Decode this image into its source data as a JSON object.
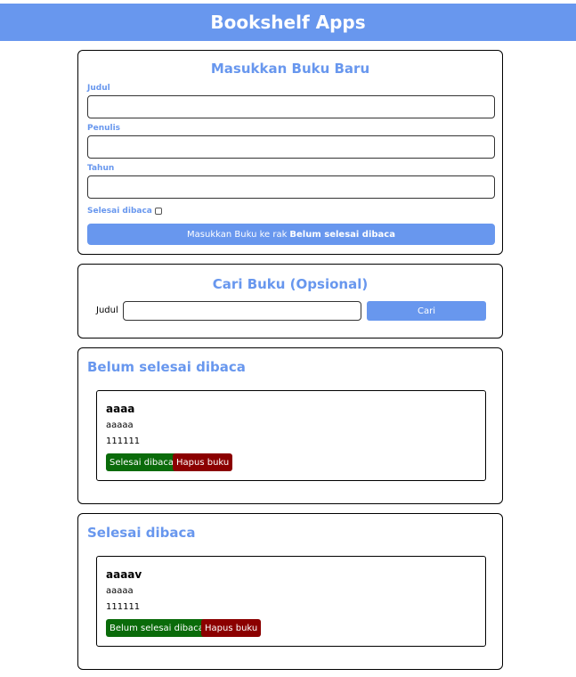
{
  "app": {
    "title": "Bookshelf Apps"
  },
  "input_form": {
    "title": "Masukkan Buku Baru",
    "judul_label": "Judul",
    "penulis_label": "Penulis",
    "tahun_label": "Tahun",
    "judul_value": "",
    "penulis_value": "",
    "tahun_value": "",
    "checkbox_label": "Selesai dibaca",
    "checkbox_checked": false,
    "submit_prefix": "Masukkan Buku ke rak",
    "submit_shelf": "Belum selesai dibaca"
  },
  "search": {
    "title": "Cari Buku (Opsional)",
    "label": "Judul",
    "value": "",
    "button_label": "Cari"
  },
  "incomplete_shelf": {
    "title": "Belum selesai dibaca",
    "books": [
      {
        "title": "aaaa",
        "author": "aaaaa",
        "year": "111111",
        "action_label": "Selesai dibaca",
        "delete_label": "Hapus buku"
      }
    ]
  },
  "complete_shelf": {
    "title": "Selesai dibaca",
    "books": [
      {
        "title": "aaaav",
        "author": "aaaaa",
        "year": "111111",
        "action_label": "Belum selesai dibaca",
        "delete_label": "Hapus buku"
      }
    ]
  }
}
